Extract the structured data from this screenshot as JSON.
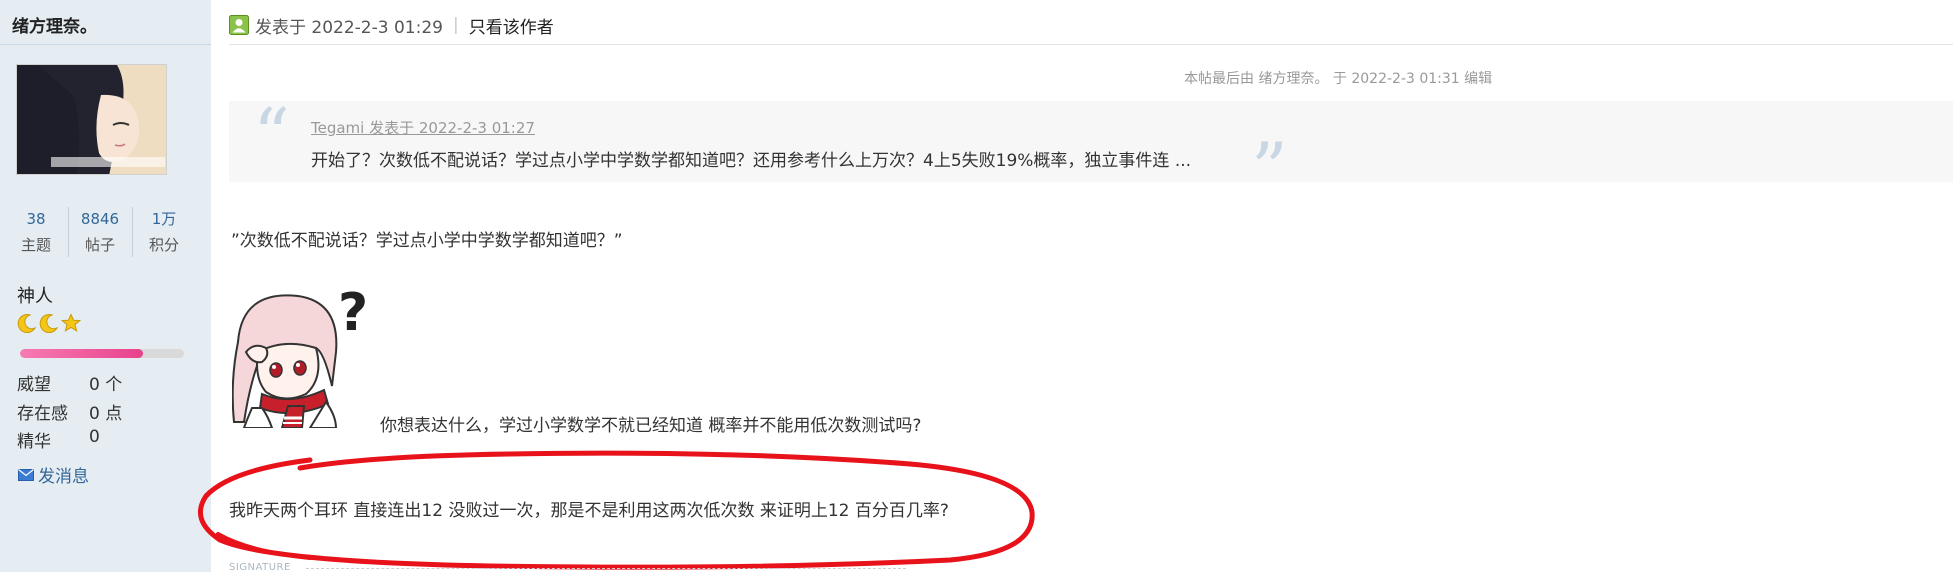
{
  "sidebar": {
    "username": "绪方理奈。",
    "stats": [
      {
        "value": "38",
        "label": "主题"
      },
      {
        "value": "8846",
        "label": "帖子"
      },
      {
        "value": "1万",
        "label": "积分"
      }
    ],
    "rank_title": "神人",
    "rank_icons": [
      "moon-icon",
      "moon-icon",
      "star-icon"
    ],
    "rank_progress": 0.75,
    "attributes": [
      {
        "label": "威望",
        "value": "0 个"
      },
      {
        "label": "存在感",
        "value": "0 点"
      },
      {
        "label": "精华",
        "value": "0"
      }
    ],
    "send_message": "发消息"
  },
  "post": {
    "posted_at": "发表于 2022-2-3 01:29",
    "separator": "|",
    "only_author": "只看该作者",
    "edit_note": "本帖最后由 绪方理奈。 于 2022-2-3 01:31 编辑",
    "quote": {
      "author_line": "Tegami 发表于 2022-2-3 01:27",
      "text": "开始了？次数低不配说话？学过点小学中学数学都知道吧？还用参考什么上万次？4上5失败19%概率，独立事件连 ..."
    },
    "line1": "”次数低不配说话？学过点小学中学数学都知道吧？”",
    "sticker_caption": "你想表达什么，学过小学数学不就已经知道 概率并不能用低次数测试吗?",
    "line3": "我昨天两个耳环 直接连出12 没败过一次，那是不是利用这两次低次数 来证明上12 百分百几率?",
    "signature_label": "SIGNATURE"
  },
  "colors": {
    "sidebar_bg": "#e5edf2",
    "link_blue": "#336699",
    "progress_pink": "#e8428c",
    "annotation_red": "#e8121b",
    "quote_bg": "#f7f7f7"
  }
}
